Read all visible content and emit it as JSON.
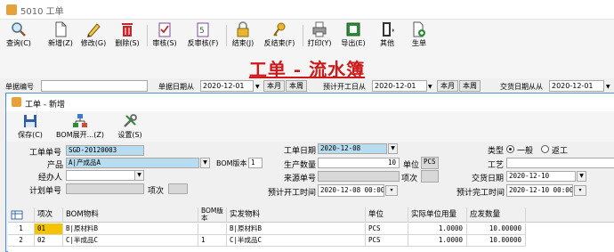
{
  "window": {
    "title": "5010 工单"
  },
  "toolbar": [
    {
      "key": "query",
      "label": "查询(C)"
    },
    {
      "key": "new",
      "label": "新增(Z)"
    },
    {
      "key": "edit",
      "label": "修改(G)"
    },
    {
      "key": "delete",
      "label": "删除(S)"
    },
    {
      "key": "audit",
      "label": "审核(S)"
    },
    {
      "key": "unaudit",
      "label": "反审核(F)"
    },
    {
      "key": "close",
      "label": "结束(J)"
    },
    {
      "key": "unclose",
      "label": "反结束(F)"
    },
    {
      "key": "print",
      "label": "打印(Y)"
    },
    {
      "key": "export",
      "label": "导出(E)"
    },
    {
      "key": "other",
      "label": "其他"
    },
    {
      "key": "generate",
      "label": "生单"
    }
  ],
  "banner": {
    "title": "工单 - 流水簿"
  },
  "filters": {
    "doc_no_label": "单据编号",
    "doc_date_label": "单据日期从",
    "doc_date_value": "2020-12-01",
    "plan_start_label": "预计开工日从",
    "plan_start_value": "2020-12-01",
    "due_date_label": "交货日期从从",
    "due_date_value": "2020-12-01",
    "this_month": "本月",
    "this_week": "本周"
  },
  "dialog": {
    "title": "工单 - 新增",
    "toolbar": [
      {
        "key": "save",
        "label": "保存(C)"
      },
      {
        "key": "bom_expand",
        "label": "BOM展开...(Z)"
      },
      {
        "key": "settings",
        "label": "设置(S)"
      }
    ],
    "form": {
      "order_no_label": "工单单号",
      "order_no_value": "SGD-20120003",
      "product_label": "产品",
      "product_value": "A|产成品A",
      "bom_version_label": "BOM版本",
      "bom_version_value": "1",
      "handler_label": "经办人",
      "handler_value": "",
      "plan_no_label": "计划单号",
      "plan_no_value": "",
      "item_label": "项次",
      "item_value": "",
      "order_date_label": "工单日期",
      "order_date_value": "2020-12-08",
      "qty_label": "生产数量",
      "qty_value": "10",
      "unit_label": "单位",
      "unit_value": "PCS",
      "source_no_label": "来源单号",
      "source_no_value": "",
      "source_item_label": "项次",
      "source_item_value": "",
      "plan_start_label": "预计开工时间",
      "plan_start_value": "2020-12-08 00:00",
      "type_label": "类型",
      "type_general": "一般",
      "type_outsource": "返工",
      "process_label": "工艺",
      "process_value": "",
      "due_date_label": "交货日期",
      "due_date_value": "2020-12-10",
      "plan_end_label": "预计完工时间",
      "plan_end_value": "2020-12-10 00:00"
    },
    "grid": {
      "headers": {
        "seq": "项次",
        "bom_item": "BOM物料",
        "bom_ver": "BOM版本",
        "actual_item": "实发物料",
        "unit": "单位",
        "unit_qty": "实际单位用量",
        "issue_qty": "应发数量"
      },
      "rows": [
        {
          "row": "1",
          "seq": "01",
          "bom_item": "B|原材料B",
          "bom_ver": "",
          "actual_item": "B|原材料B",
          "unit": "PCS",
          "unit_qty": "1.0000",
          "issue_qty": "10.00000"
        },
        {
          "row": "2",
          "seq": "02",
          "bom_item": "C|半成品C",
          "bom_ver": "1",
          "actual_item": "C|半成品C",
          "unit": "PCS",
          "unit_qty": "1.0000",
          "issue_qty": "10.00000"
        }
      ]
    }
  }
}
